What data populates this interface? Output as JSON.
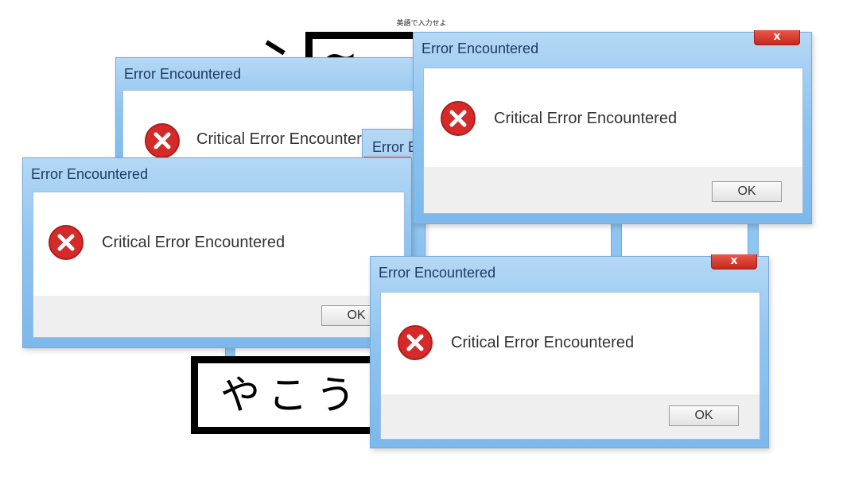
{
  "instruction": "英語で入力せよ",
  "input_boxes": {
    "top_text": "~",
    "bottom_text": "やこう"
  },
  "error_dialog": {
    "title": "Error Encountered",
    "message": "Critical Error Encountered",
    "ok_label": "OK",
    "close_label": "x",
    "icon": "error-x-icon"
  },
  "partial_dialog": {
    "title": "Error E"
  },
  "colors": {
    "frame_blue": "#8ec4f0",
    "close_red": "#d3372a",
    "error_icon_red": "#d42a2a",
    "title_text": "#1f3a66"
  }
}
